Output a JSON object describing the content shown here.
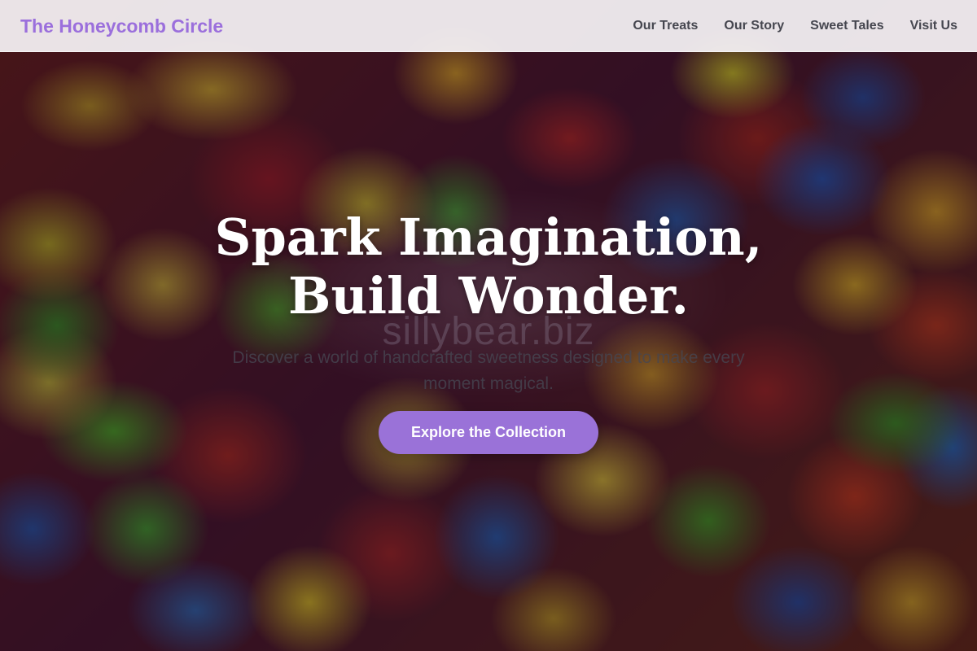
{
  "header": {
    "brand": "The Honeycomb Circle",
    "nav": [
      {
        "label": "Our Treats"
      },
      {
        "label": "Our Story"
      },
      {
        "label": "Sweet Tales"
      },
      {
        "label": "Visit Us"
      }
    ]
  },
  "hero": {
    "title_line1": "Spark Imagination,",
    "title_line2": "Build Wonder.",
    "watermark": "sillybear.biz",
    "subtitle": "Discover a world of handcrafted sweetness designed to make every moment magical.",
    "cta_label": "Explore the Collection"
  },
  "colors": {
    "brand": "#9b6fdc",
    "cta_background": "#9a72d8",
    "header_background": "#f6f3f6",
    "nav_text": "#45464f"
  }
}
